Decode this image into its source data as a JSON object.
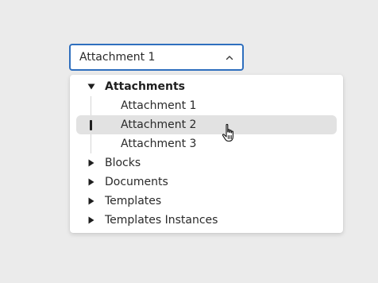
{
  "select": {
    "value": "Attachment 1",
    "chevron_icon": "chevron-up-icon"
  },
  "tree": {
    "items": [
      {
        "label": "Attachments",
        "expanded": true,
        "level": 0,
        "bold": true,
        "children": [
          {
            "label": "Attachment 1",
            "level": 1
          },
          {
            "label": "Attachment 2",
            "level": 1,
            "highlighted": true
          },
          {
            "label": "Attachment 3",
            "level": 1
          }
        ]
      },
      {
        "label": "Blocks",
        "expanded": false,
        "level": 0
      },
      {
        "label": "Documents",
        "expanded": false,
        "level": 0
      },
      {
        "label": "Templates",
        "expanded": false,
        "level": 0
      },
      {
        "label": "Templates Instances",
        "expanded": false,
        "level": 0
      }
    ]
  },
  "colors": {
    "focus_border": "#2f6fbe",
    "highlight_bg": "#e2e2e2",
    "page_bg": "#ebebeb"
  },
  "cursor": "hand-pointer-icon"
}
